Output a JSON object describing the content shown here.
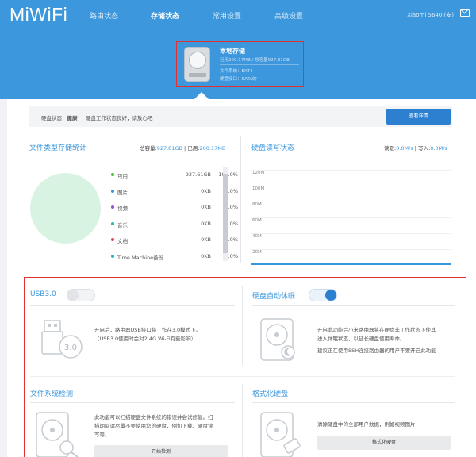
{
  "header": {
    "logo": "MiWiFi",
    "nav": [
      "路由状态",
      "存储状态",
      "常用设置",
      "高级设置"
    ],
    "device": "Xiaomi 5640 (安)",
    "icons": [
      "mail-icon"
    ]
  },
  "storage_card": {
    "title": "本地存储",
    "used_total": "已用200.17MB / 总容量927.81GB",
    "filesystem": "文件系统：EXT4",
    "interface": "硬盘接口：SATA的"
  },
  "status": {
    "label": "硬盘状态：",
    "value": "健康",
    "message": "硬盘工作状态良好，请放心吧",
    "detail_button": "查看详情"
  },
  "file_stats": {
    "title": "文件类型存储统计",
    "total_label": "总容量:",
    "total_value": "927.81GB",
    "used_label": "已用:",
    "used_value": "200.17MB",
    "rows": [
      {
        "name": "可用",
        "size": "927.61GB",
        "percent": "100.0%",
        "color": "#4fb848"
      },
      {
        "name": "图片",
        "size": "0KB",
        "percent": "0.0%",
        "color": "#3c97dc"
      },
      {
        "name": "视频",
        "size": "0KB",
        "percent": "0.0%",
        "color": "#9b4fd6"
      },
      {
        "name": "音乐",
        "size": "0KB",
        "percent": "0.0%",
        "color": "#2bb6a8"
      },
      {
        "name": "文档",
        "size": "0KB",
        "percent": "0.0%",
        "color": "#e0485a"
      },
      {
        "name": "Time Machine备份",
        "size": "0KB",
        "percent": "0.0%",
        "color": "#25b5c9"
      }
    ],
    "donut_color": "#d9f3e3"
  },
  "rw_status": {
    "title": "硬盘读写状态",
    "read_label": "读取:",
    "read_value": "0.0M/s",
    "write_label": "写入:",
    "write_value": "0.0M/s",
    "y_labels": [
      "120M",
      "100M",
      "80M",
      "60M",
      "40M",
      "20M"
    ]
  },
  "usb3": {
    "title": "USB3.0",
    "enabled": false,
    "line1": "开启后，路由器USB接口将工作在3.0模式下。",
    "line2": "（USB3.0使用时会对2.4G Wi-Fi有些影响）",
    "icon_label": "3.0"
  },
  "sleep": {
    "title": "硬盘自动休眠",
    "enabled": true,
    "line1": "开启此功能后小米路由器将在硬盘非工作状态下使其",
    "line2": "进入休眠状态，以延长硬盘使用寿命。",
    "line3": "建议正在使用SSH连接路由器的用户不要开启此功能"
  },
  "fscheck": {
    "title": "文件系统检测",
    "line1": "此功能可以扫描硬盘文件系统的错误并尝试修复。扫",
    "line2": "描期间请尽量不要使用您的硬盘，例如下载、硬盘读",
    "line3": "写等。",
    "button": "开始检测"
  },
  "format": {
    "title": "格式化硬盘",
    "line1": "清除硬盘中的全部用户数据，例如视频图片",
    "button": "格式化硬盘"
  },
  "colors": {
    "accent": "#3c97dc",
    "highlight_border": "#e1312f",
    "healthy": "#4fb848"
  }
}
